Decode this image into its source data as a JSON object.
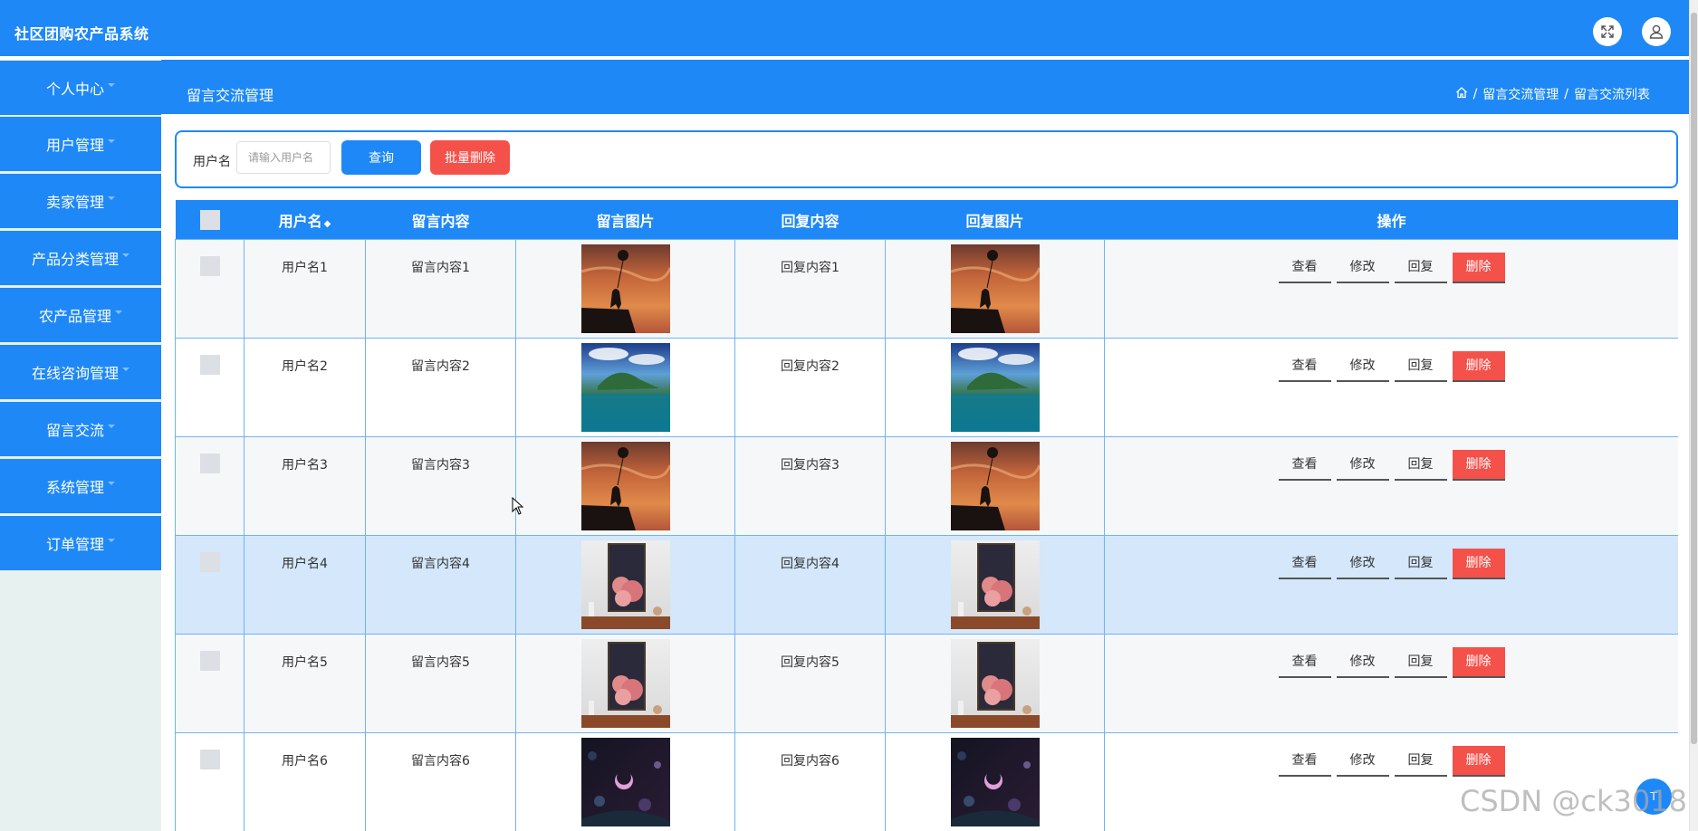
{
  "app": {
    "title": "社区团购农产品系统"
  },
  "sidebar": {
    "items": [
      {
        "label": "个人中心"
      },
      {
        "label": "用户管理"
      },
      {
        "label": "卖家管理"
      },
      {
        "label": "产品分类管理"
      },
      {
        "label": "农产品管理"
      },
      {
        "label": "在线咨询管理"
      },
      {
        "label": "留言交流"
      },
      {
        "label": "系统管理"
      },
      {
        "label": "订单管理"
      }
    ]
  },
  "header": {
    "title": "留言交流管理",
    "breadcrumb": [
      "留言交流管理",
      "留言交流列表"
    ],
    "breadcrumb_sep": "/"
  },
  "search": {
    "label": "用户名",
    "placeholder": "请输入用户名",
    "query_label": "查询",
    "batch_delete_label": "批量删除"
  },
  "table": {
    "columns": [
      "用户名",
      "留言内容",
      "留言图片",
      "回复内容",
      "回复图片",
      "操作"
    ],
    "ops": {
      "view": "查看",
      "edit": "修改",
      "reply": "回复",
      "delete": "删除"
    },
    "rows": [
      {
        "username": "用户名1",
        "content": "留言内容1",
        "reply": "回复内容1",
        "image": "girl-balloon-sunset"
      },
      {
        "username": "用户名2",
        "content": "留言内容2",
        "reply": "回复内容2",
        "image": "island-sea"
      },
      {
        "username": "用户名3",
        "content": "留言内容3",
        "reply": "回复内容3",
        "image": "girl-balloon-sunset"
      },
      {
        "username": "用户名4",
        "content": "留言内容4",
        "reply": "回复内容4",
        "image": "pink-clouds-painting"
      },
      {
        "username": "用户名5",
        "content": "留言内容5",
        "reply": "回复内容5",
        "image": "pink-clouds-painting"
      },
      {
        "username": "用户名6",
        "content": "留言内容6",
        "reply": "回复内容6",
        "image": "night-moon-flowers"
      }
    ]
  },
  "float_button": {
    "label": "T"
  },
  "watermark": "CSDN @ck3018",
  "colors": {
    "primary": "#1e88f7",
    "danger": "#f5514b",
    "sidebar_bg": "#e7f1f0",
    "row_highlight": "#d4e7fb",
    "row_border": "#6fb4f5"
  }
}
